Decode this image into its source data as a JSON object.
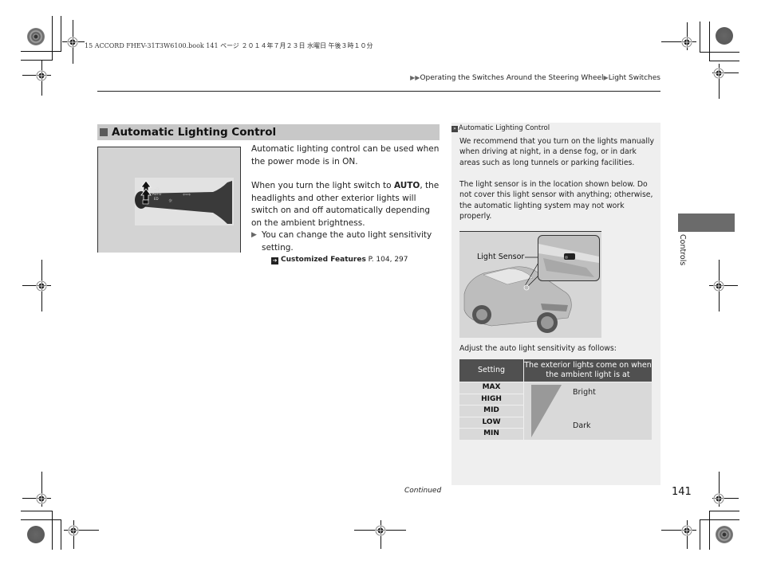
{
  "print_header": "15 ACCORD FHEV-31T3W6100.book  141 ページ  ２０１４年７月２３日  水曜日  午後３時１０分",
  "breadcrumb": {
    "items": [
      "Operating the Switches Around the Steering Wheel",
      "Light Switches"
    ]
  },
  "section": {
    "title": "Automatic Lighting Control"
  },
  "figure_lever": {
    "labels": [
      "AUTO"
    ]
  },
  "body": {
    "para1": "Automatic lighting control can be used when the power mode is in ON.",
    "para2_pre": "When you turn the light switch to ",
    "para2_bold": "AUTO",
    "para2_post": ", the headlights and other exterior lights will switch on and off automatically depending on the ambient brightness.",
    "note": "You can change the auto light sensitivity setting.",
    "xref_bold": "Customized Features",
    "xref_pages": " P. 104, 297"
  },
  "side_panel": {
    "title": "Automatic Lighting Control",
    "para1": "We recommend that you turn on the lights manually when driving at night, in a dense fog, or in dark areas such as long tunnels or parking facilities.",
    "para2": "The light sensor is in the location shown below. Do not cover this light sensor with anything; otherwise, the automatic lighting system may not work properly.",
    "sensor_label": "Light Sensor",
    "table_intro": "Adjust the auto light sensitivity as follows:",
    "table": {
      "headers": [
        "Setting",
        "The exterior lights come on when the ambient light is at"
      ],
      "settings": [
        "MAX",
        "HIGH",
        "MID",
        "LOW",
        "MIN"
      ],
      "bright_label": "Bright",
      "dark_label": "Dark"
    }
  },
  "thumb_tab": "Controls",
  "footer": {
    "continued": "Continued",
    "page_number": "141"
  }
}
